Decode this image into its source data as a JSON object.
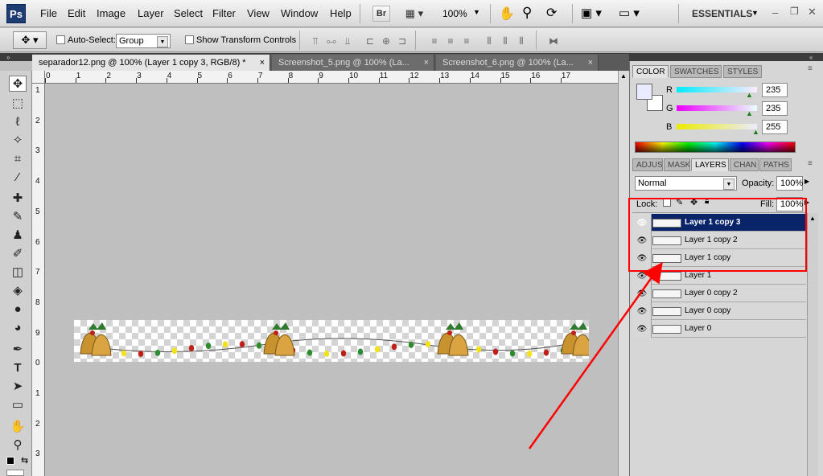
{
  "app": {
    "logo": "Ps",
    "menu": [
      "File",
      "Edit",
      "Image",
      "Layer",
      "Select",
      "Filter",
      "View",
      "Window",
      "Help"
    ],
    "toolbar": {
      "bridge_label": "Br",
      "zoom": "100%"
    },
    "workspace": "ESSENTIALS"
  },
  "options_bar": {
    "auto_select_label": "Auto-Select:",
    "auto_select_value": "Group",
    "show_transform_label": "Show Transform Controls"
  },
  "documents": [
    {
      "title": "separador12.png @ 100% (Layer 1 copy 3, RGB/8) *",
      "active": true
    },
    {
      "title": "Screenshot_5.png @ 100% (La...",
      "active": false
    },
    {
      "title": "Screenshot_6.png @ 100% (La...",
      "active": false
    }
  ],
  "ruler_top": [
    "0",
    "1",
    "2",
    "3",
    "4",
    "5",
    "6",
    "7",
    "8",
    "9",
    "10",
    "11",
    "12",
    "13",
    "14",
    "15",
    "16",
    "17"
  ],
  "ruler_left": [
    "1",
    "2",
    "3",
    "4",
    "5",
    "6",
    "7",
    "8",
    "9",
    "0",
    "1",
    "2",
    "3",
    "4"
  ],
  "color_panel": {
    "tabs": [
      "COLOR",
      "SWATCHES",
      "STYLES"
    ],
    "r_label": "R",
    "r_value": "235",
    "g_label": "G",
    "g_value": "235",
    "b_label": "B",
    "b_value": "255"
  },
  "layers_panel": {
    "tabs": [
      "ADJUS",
      "MASK",
      "LAYERS",
      "CHAN",
      "PATHS"
    ],
    "blend_mode": "Normal",
    "opacity_label": "Opacity:",
    "opacity_value": "100%",
    "lock_label": "Lock:",
    "fill_label": "Fill:",
    "fill_value": "100%",
    "layers": [
      {
        "name": "Layer 1 copy 3",
        "selected": true
      },
      {
        "name": "Layer 1 copy 2",
        "selected": false
      },
      {
        "name": "Layer 1 copy",
        "selected": false
      },
      {
        "name": "Layer 1",
        "selected": false
      },
      {
        "name": "Layer 0 copy 2",
        "selected": false
      },
      {
        "name": "Layer 0 copy",
        "selected": false
      },
      {
        "name": "Layer 0",
        "selected": false
      }
    ]
  },
  "colors": {
    "annotation": "#ff0000",
    "selected_layer": "#0a246a"
  }
}
